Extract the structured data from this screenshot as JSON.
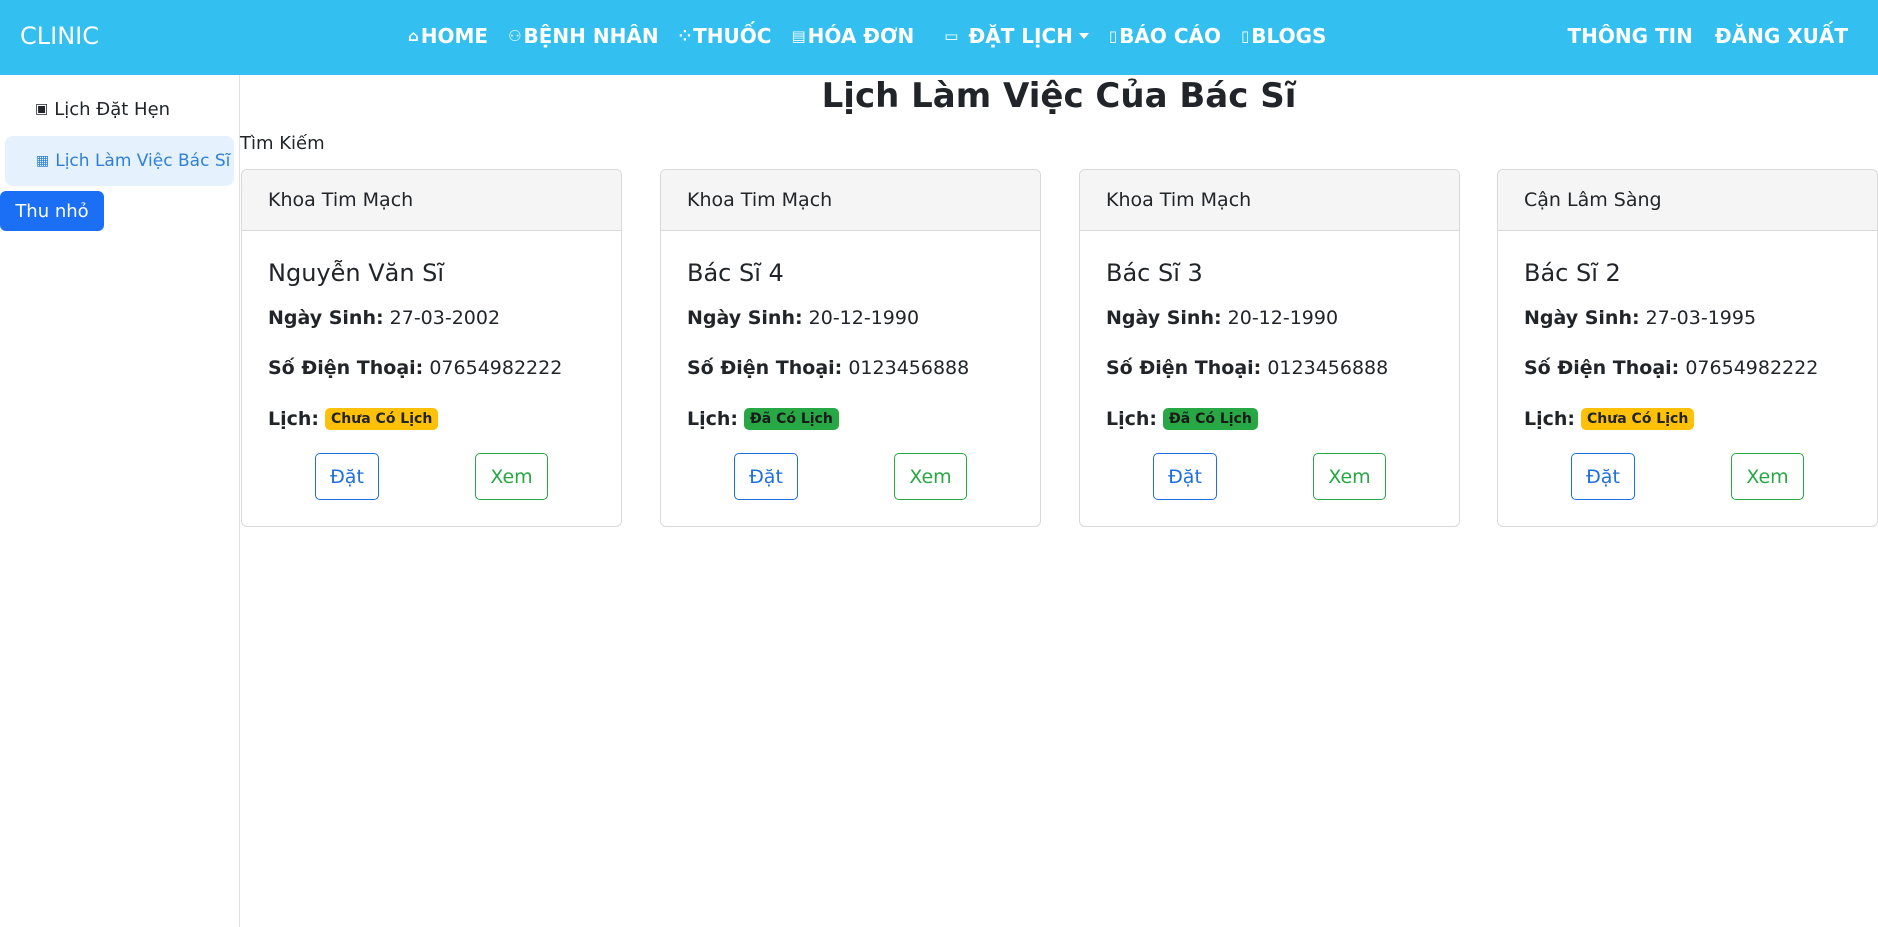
{
  "navbar": {
    "brand": "CLINIC",
    "items": [
      {
        "label": "HOME",
        "icon": "home-icon"
      },
      {
        "label": "BỆNH NHÂN",
        "icon": "people-icon"
      },
      {
        "label": "THUỐC",
        "icon": "pills-icon"
      },
      {
        "label": "HÓA ĐƠN",
        "icon": "receipt-icon"
      },
      {
        "label": "ĐẶT LỊCH",
        "icon": "calendar-check-icon"
      },
      {
        "label": "BÁO CÁO",
        "icon": "document-icon"
      },
      {
        "label": "BLOGS",
        "icon": "document-icon"
      }
    ],
    "right": [
      {
        "label": "THÔNG TIN"
      },
      {
        "label": "ĐĂNG XUẤT"
      }
    ],
    "color": "#33bfef"
  },
  "sidebar": {
    "items": [
      {
        "label": "Lịch Đặt Hẹn",
        "icon": "archive-icon"
      },
      {
        "label": "Lịch Làm Việc Bác Sĩ",
        "icon": "calendar-icon",
        "active": true
      }
    ],
    "collapse_label": "Thu nhỏ"
  },
  "main": {
    "title": "Lịch Làm Việc Của Bác Sĩ",
    "search_label": "Tìm Kiếm",
    "labels": {
      "dob": "Ngày Sinh:",
      "phone": "Số Điện Thoại:",
      "schedule": "Lịch:",
      "book": "Đặt",
      "view": "Xem"
    },
    "cards": [
      {
        "department": "Khoa Tim Mạch",
        "name": "Nguyễn Văn Sĩ",
        "dob": "27-03-2002",
        "phone": "07654982222",
        "status": "Chưa Có Lịch",
        "status_color": "#ffc107"
      },
      {
        "department": "Khoa Tim Mạch",
        "name": "Bác Sĩ 4",
        "dob": "20-12-1990",
        "phone": "0123456888",
        "status": "Đã Có Lịch",
        "status_color": "#28a745"
      },
      {
        "department": "Khoa Tim Mạch",
        "name": "Bác Sĩ 3",
        "dob": "20-12-1990",
        "phone": "0123456888",
        "status": "Đã Có Lịch",
        "status_color": "#28a745"
      },
      {
        "department": "Cận Lâm Sàng",
        "name": "Bác Sĩ 2",
        "dob": "27-03-1995",
        "phone": "07654982222",
        "status": "Chưa Có Lịch",
        "status_color": "#ffc107"
      }
    ]
  }
}
